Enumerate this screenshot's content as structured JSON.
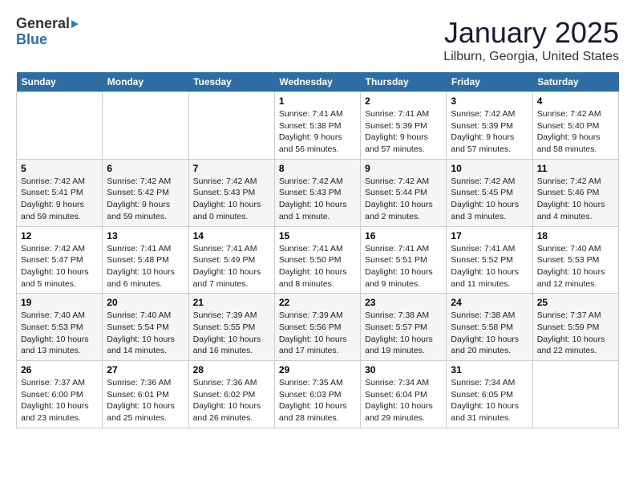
{
  "logo": {
    "general": "General",
    "blue": "Blue"
  },
  "header": {
    "title": "January 2025",
    "subtitle": "Lilburn, Georgia, United States"
  },
  "weekdays": [
    "Sunday",
    "Monday",
    "Tuesday",
    "Wednesday",
    "Thursday",
    "Friday",
    "Saturday"
  ],
  "weeks": [
    [
      {
        "day": "",
        "content": ""
      },
      {
        "day": "",
        "content": ""
      },
      {
        "day": "",
        "content": ""
      },
      {
        "day": "1",
        "content": "Sunrise: 7:41 AM\nSunset: 5:38 PM\nDaylight: 9 hours and 56 minutes."
      },
      {
        "day": "2",
        "content": "Sunrise: 7:41 AM\nSunset: 5:39 PM\nDaylight: 9 hours and 57 minutes."
      },
      {
        "day": "3",
        "content": "Sunrise: 7:42 AM\nSunset: 5:39 PM\nDaylight: 9 hours and 57 minutes."
      },
      {
        "day": "4",
        "content": "Sunrise: 7:42 AM\nSunset: 5:40 PM\nDaylight: 9 hours and 58 minutes."
      }
    ],
    [
      {
        "day": "5",
        "content": "Sunrise: 7:42 AM\nSunset: 5:41 PM\nDaylight: 9 hours and 59 minutes."
      },
      {
        "day": "6",
        "content": "Sunrise: 7:42 AM\nSunset: 5:42 PM\nDaylight: 9 hours and 59 minutes."
      },
      {
        "day": "7",
        "content": "Sunrise: 7:42 AM\nSunset: 5:43 PM\nDaylight: 10 hours and 0 minutes."
      },
      {
        "day": "8",
        "content": "Sunrise: 7:42 AM\nSunset: 5:43 PM\nDaylight: 10 hours and 1 minute."
      },
      {
        "day": "9",
        "content": "Sunrise: 7:42 AM\nSunset: 5:44 PM\nDaylight: 10 hours and 2 minutes."
      },
      {
        "day": "10",
        "content": "Sunrise: 7:42 AM\nSunset: 5:45 PM\nDaylight: 10 hours and 3 minutes."
      },
      {
        "day": "11",
        "content": "Sunrise: 7:42 AM\nSunset: 5:46 PM\nDaylight: 10 hours and 4 minutes."
      }
    ],
    [
      {
        "day": "12",
        "content": "Sunrise: 7:42 AM\nSunset: 5:47 PM\nDaylight: 10 hours and 5 minutes."
      },
      {
        "day": "13",
        "content": "Sunrise: 7:41 AM\nSunset: 5:48 PM\nDaylight: 10 hours and 6 minutes."
      },
      {
        "day": "14",
        "content": "Sunrise: 7:41 AM\nSunset: 5:49 PM\nDaylight: 10 hours and 7 minutes."
      },
      {
        "day": "15",
        "content": "Sunrise: 7:41 AM\nSunset: 5:50 PM\nDaylight: 10 hours and 8 minutes."
      },
      {
        "day": "16",
        "content": "Sunrise: 7:41 AM\nSunset: 5:51 PM\nDaylight: 10 hours and 9 minutes."
      },
      {
        "day": "17",
        "content": "Sunrise: 7:41 AM\nSunset: 5:52 PM\nDaylight: 10 hours and 11 minutes."
      },
      {
        "day": "18",
        "content": "Sunrise: 7:40 AM\nSunset: 5:53 PM\nDaylight: 10 hours and 12 minutes."
      }
    ],
    [
      {
        "day": "19",
        "content": "Sunrise: 7:40 AM\nSunset: 5:53 PM\nDaylight: 10 hours and 13 minutes."
      },
      {
        "day": "20",
        "content": "Sunrise: 7:40 AM\nSunset: 5:54 PM\nDaylight: 10 hours and 14 minutes."
      },
      {
        "day": "21",
        "content": "Sunrise: 7:39 AM\nSunset: 5:55 PM\nDaylight: 10 hours and 16 minutes."
      },
      {
        "day": "22",
        "content": "Sunrise: 7:39 AM\nSunset: 5:56 PM\nDaylight: 10 hours and 17 minutes."
      },
      {
        "day": "23",
        "content": "Sunrise: 7:38 AM\nSunset: 5:57 PM\nDaylight: 10 hours and 19 minutes."
      },
      {
        "day": "24",
        "content": "Sunrise: 7:38 AM\nSunset: 5:58 PM\nDaylight: 10 hours and 20 minutes."
      },
      {
        "day": "25",
        "content": "Sunrise: 7:37 AM\nSunset: 5:59 PM\nDaylight: 10 hours and 22 minutes."
      }
    ],
    [
      {
        "day": "26",
        "content": "Sunrise: 7:37 AM\nSunset: 6:00 PM\nDaylight: 10 hours and 23 minutes."
      },
      {
        "day": "27",
        "content": "Sunrise: 7:36 AM\nSunset: 6:01 PM\nDaylight: 10 hours and 25 minutes."
      },
      {
        "day": "28",
        "content": "Sunrise: 7:36 AM\nSunset: 6:02 PM\nDaylight: 10 hours and 26 minutes."
      },
      {
        "day": "29",
        "content": "Sunrise: 7:35 AM\nSunset: 6:03 PM\nDaylight: 10 hours and 28 minutes."
      },
      {
        "day": "30",
        "content": "Sunrise: 7:34 AM\nSunset: 6:04 PM\nDaylight: 10 hours and 29 minutes."
      },
      {
        "day": "31",
        "content": "Sunrise: 7:34 AM\nSunset: 6:05 PM\nDaylight: 10 hours and 31 minutes."
      },
      {
        "day": "",
        "content": ""
      }
    ]
  ]
}
